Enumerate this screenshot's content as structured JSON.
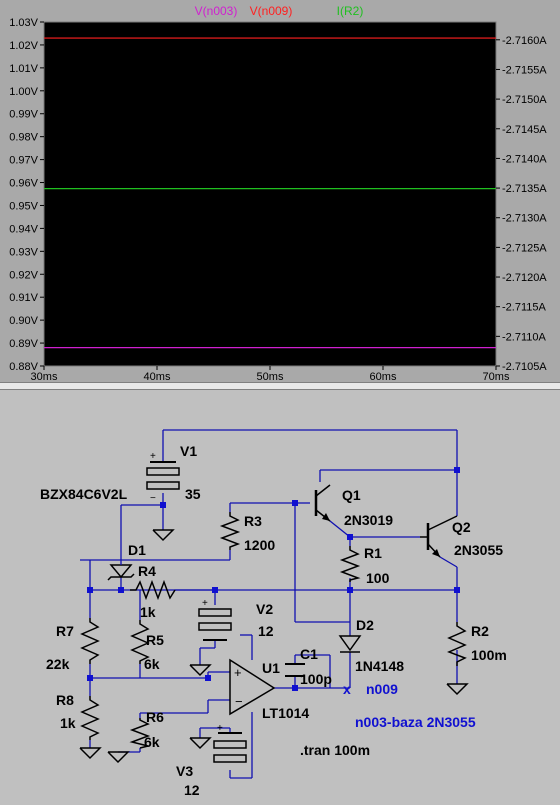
{
  "plot": {
    "legend": [
      {
        "label": "V(n003)",
        "color": "#d020d0"
      },
      {
        "label": "V(n009)",
        "color": "#ff2020"
      },
      {
        "label": "I(R2)",
        "color": "#20c020"
      }
    ],
    "left_ticks": [
      "1.03V",
      "1.02V",
      "1.01V",
      "1.00V",
      "0.99V",
      "0.98V",
      "0.97V",
      "0.96V",
      "0.95V",
      "0.94V",
      "0.93V",
      "0.92V",
      "0.91V",
      "0.90V",
      "0.89V",
      "0.88V"
    ],
    "right_ticks": [
      "2.7160A",
      "2.7155A",
      "2.7150A",
      "2.7145A",
      "2.7140A",
      "2.7135A",
      "2.7130A",
      "2.7125A",
      "2.7120A",
      "2.7115A",
      "2.7110A",
      "2.7105A"
    ],
    "x_ticks": [
      "30ms",
      "40ms",
      "50ms",
      "60ms",
      "70ms"
    ]
  },
  "chart_data": {
    "type": "line",
    "x": [
      30,
      70
    ],
    "xlim": [
      30,
      70
    ],
    "ylim_left": [
      0.88,
      1.03
    ],
    "ylim_right": [
      2.7105,
      2.7163
    ],
    "grid": false,
    "series": [
      {
        "name": "V(n003)",
        "axis": "left",
        "color": "#d020d0",
        "values": [
          0.888,
          0.888
        ]
      },
      {
        "name": "V(n009)",
        "axis": "left",
        "color": "#ff2020",
        "values": [
          1.023,
          1.023
        ]
      },
      {
        "name": "I(R2)",
        "axis": "right",
        "color": "#20c020",
        "values": [
          2.71349,
          2.71349
        ]
      }
    ]
  },
  "schematic": {
    "labels": {
      "v1": "V1",
      "v1_val": "35",
      "dz": "BZX84C6V2L",
      "r3": "R3",
      "r3_val": "1200",
      "q1": "Q1",
      "q1_val": "2N3019",
      "q2": "Q2",
      "q2_val": "2N3055",
      "d1": "D1",
      "r4": "R4",
      "r4_val": "1k",
      "r1": "R1",
      "r1_val": "100",
      "v2": "V2",
      "v2_val": "12",
      "r7": "R7",
      "r7_val": "22k",
      "r5": "R5",
      "r5_val": "6k",
      "d2": "D2",
      "d2_val": "1N4148",
      "r2": "R2",
      "r2_val": "100m",
      "c1": "C1",
      "c1_val": "100p",
      "u1": "U1",
      "u1_val": "LT1014",
      "n009": "n009",
      "net_cross": "x",
      "r8": "R8",
      "r8_val": "1k",
      "r6": "R6",
      "r6_val": "6k",
      "comment": "n003-baza 2N3055",
      "v3": "V3",
      "v3_val": "12",
      "tran": ".tran 100m"
    }
  }
}
